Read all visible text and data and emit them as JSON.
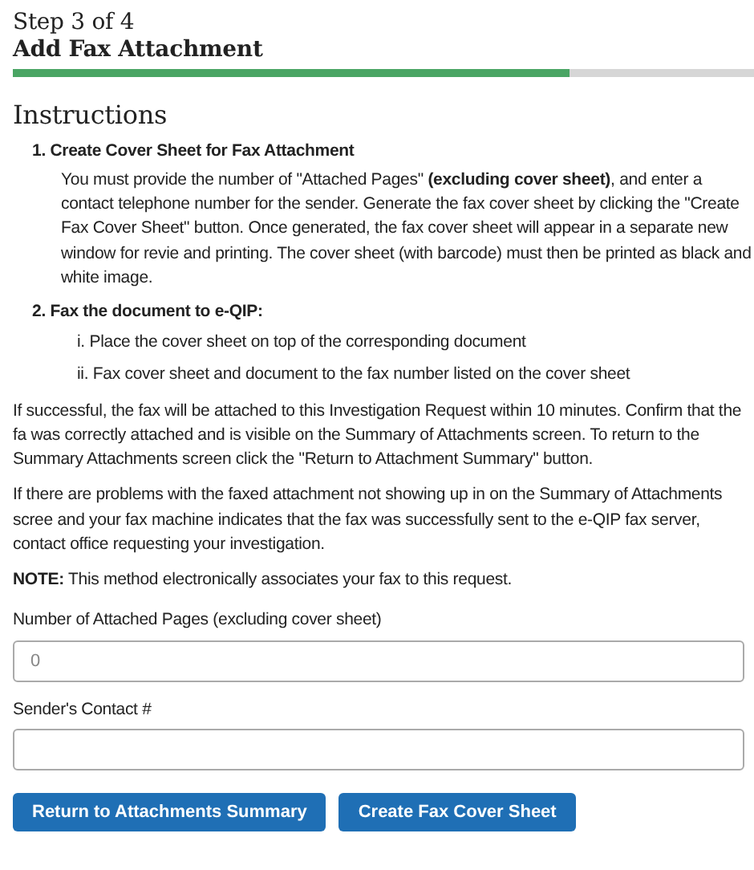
{
  "step": "Step 3 of 4",
  "title": "Add Fax Attachment",
  "progress": {
    "level": 0.75
  },
  "instructions_heading": "Instructions",
  "steps": [
    {
      "number": "1.",
      "heading": "Create Cover Sheet for Fax Attachment",
      "body": "You must provide the number of \"Attached Pages\" **(excluding cover sheet)**, and enter a contact telephone number for the sender. Generate the fax cover sheet by clicking the \"Create Fax Cover Sheet\" button. Once generated, the fax cover sheet will appear in a separate new window for revie and printing. The cover sheet (with barcode) must then be printed as black and white image."
    },
    {
      "number": "2.",
      "heading": "Fax the document to e-QIP:",
      "substeps": [
        {
          "number": "i.",
          "text": "Place the cover sheet on top of the corresponding document"
        },
        {
          "number": "ii.",
          "text": "Fax cover sheet and document to the fax number listed on the cover sheet"
        }
      ]
    }
  ],
  "paragraphs": [
    "If successful, the fax will be attached to this Investigation Request within 10 minutes. Confirm that the fa was correctly attached and is visible on the Summary of Attachments screen. To return to the Summary Attachments screen click the \"Return to Attachment Summary\" button.",
    "If there are problems with the faxed attachment not showing up in on the Summary of Attachments scree and your fax machine indicates that the fax was successfully sent to the e-QIP fax server, contact office requesting your investigation.",
    "**NOTE:** This method electronically associates your fax to this request."
  ],
  "fields": [
    {
      "label": "Number of Attached Pages (excluding cover sheet)",
      "placeholder": "0"
    },
    {
      "label": "Sender's Contact #"
    }
  ],
  "buttons": [
    "Return to Attachments Summary",
    "Create Fax Cover Sheet"
  ]
}
